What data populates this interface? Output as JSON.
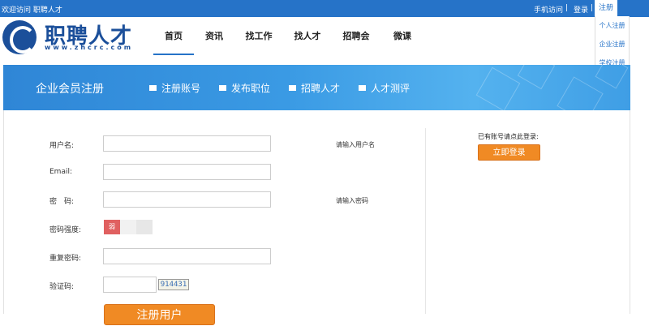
{
  "topbar": {
    "welcome": "欢迎访问 职聘人才",
    "mobile": "手机访问",
    "separator": "|",
    "login": "登录",
    "register": "注册"
  },
  "register_menu": [
    "个人注册",
    "企业注册",
    "学校注册"
  ],
  "logo": {
    "name": "职聘人才",
    "url": "www.zhcrc.com"
  },
  "nav": [
    "首页",
    "资讯",
    "找工作",
    "找人才",
    "招聘会",
    "微课"
  ],
  "banner": {
    "title": "企业会员注册",
    "steps": [
      "注册账号",
      "发布职位",
      "招聘人才",
      "人才测评"
    ]
  },
  "form": {
    "username_label": "用户名:",
    "username_hint": "请输入用户名",
    "email_label": "Email:",
    "password_label": "密　码:",
    "password_hint": "请输入密码",
    "strength_label": "密码强度:",
    "strength_level": "弱",
    "confirm_label": "重复密码:",
    "captcha_label": "验证码:",
    "captcha_image_text": "914431",
    "submit_label": "注册用户"
  },
  "side": {
    "prompt": "已有账号请点此登录:",
    "login_button": "立即登录"
  },
  "colors": {
    "topbar": "#2673c8",
    "banner": "#3a9ae4",
    "button_orange": "#f08a24",
    "strength_weak": "#e06060"
  }
}
